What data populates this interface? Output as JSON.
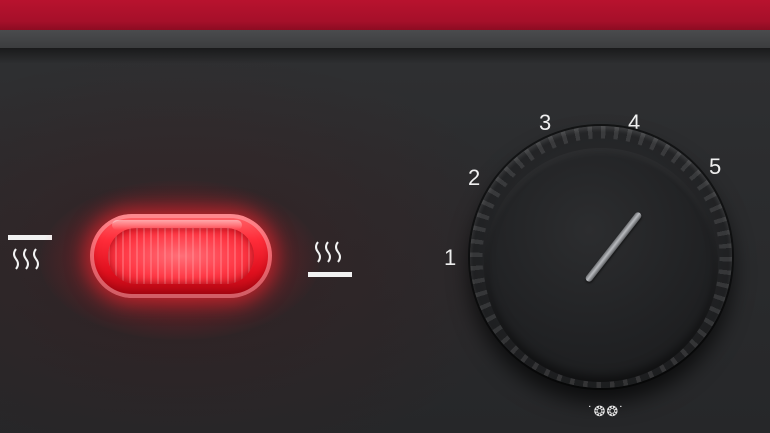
{
  "panel": {
    "accent_color": "#b8122e",
    "lamp": {
      "state": "on",
      "color": "#ff2d3a"
    },
    "heat_symbols": [
      {
        "name": "top-heat-icon"
      },
      {
        "name": "bottom-heat-icon"
      }
    ],
    "dial": {
      "labels": [
        "1",
        "2",
        "3",
        "4",
        "5"
      ],
      "defrost_symbol": "˙❂❂˙"
    }
  }
}
